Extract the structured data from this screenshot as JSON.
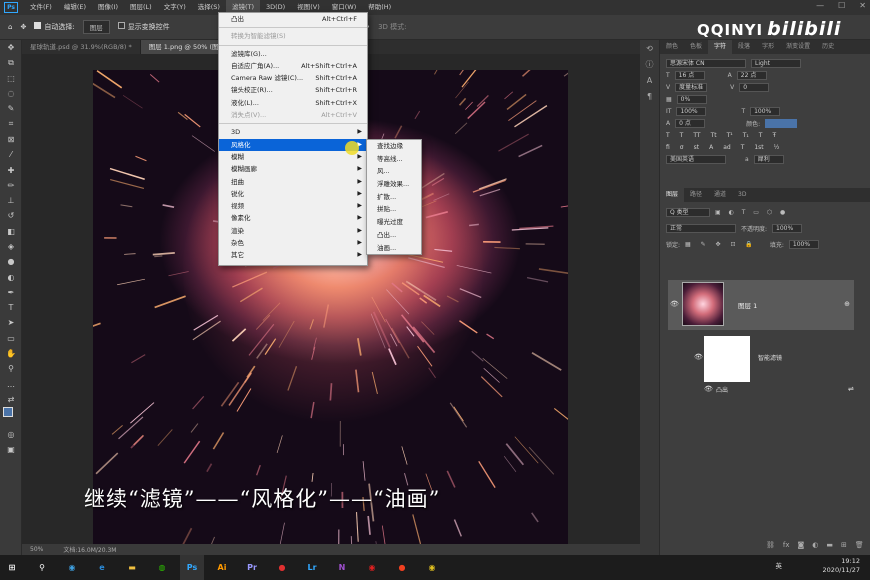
{
  "menubar": {
    "logo": "Ps",
    "items": [
      "文件(F)",
      "编辑(E)",
      "图像(I)",
      "图层(L)",
      "文字(Y)",
      "选择(S)",
      "滤镜(T)",
      "3D(D)",
      "视图(V)",
      "窗口(W)",
      "帮助(H)"
    ]
  },
  "options": {
    "auto_select_label": "自动选择:",
    "layer_value": "图层",
    "show_transform": "显示变换控件",
    "mode_3d": "3D 模式:"
  },
  "tabs": [
    {
      "label": "星球轨道.psd @ 31.9%(RGB/8) *"
    },
    {
      "label": "图层 1.png @ 50% (图层 1, RGB/8) *"
    }
  ],
  "subtitle": "继续“滤镜”——“风格化”——“油画”",
  "statusbar": {
    "zoom": "50%",
    "doc": "文档:16.0M/20.3M"
  },
  "watermark": {
    "text": "QQINYI",
    "brand": "bilibili"
  },
  "filter_menu": {
    "top": [
      {
        "label": "凸出",
        "shortcut": "Alt+Ctrl+F"
      },
      {
        "label": "转换为智能滤镜(S)",
        "shortcut": "",
        "disabled": true
      }
    ],
    "middle": [
      {
        "label": "滤镜库(G)...",
        "shortcut": ""
      },
      {
        "label": "自适应广角(A)...",
        "shortcut": "Alt+Shift+Ctrl+A"
      },
      {
        "label": "Camera Raw 滤镜(C)...",
        "shortcut": "Shift+Ctrl+A"
      },
      {
        "label": "镜头校正(R)...",
        "shortcut": "Shift+Ctrl+R"
      },
      {
        "label": "液化(L)...",
        "shortcut": "Shift+Ctrl+X"
      },
      {
        "label": "消失点(V)...",
        "shortcut": "Alt+Ctrl+V",
        "disabled": true
      }
    ],
    "groups": [
      "3D",
      "风格化",
      "模糊",
      "模糊画廊",
      "扭曲",
      "锐化",
      "视频",
      "像素化",
      "渲染",
      "杂色",
      "其它"
    ],
    "highlighted": "风格化"
  },
  "stylize_submenu": [
    "查找边缘",
    "等高线...",
    "风...",
    "浮雕效果...",
    "扩散...",
    "拼贴...",
    "曝光过度",
    "凸出...",
    "油画..."
  ],
  "right_panel": {
    "top_tabs": [
      "颜色",
      "色板",
      "字符",
      "段落",
      "字形",
      "渐变设置",
      "历史"
    ],
    "font_family": "思源宋体 CN",
    "font_style": "Light",
    "font_size": "16 点",
    "leading": "22 点",
    "kerning": "度量标准",
    "tracking": "0",
    "scale_v": "0%",
    "scale_h": "100%",
    "scale_v2": "100%",
    "baseline": "0 点",
    "color_label": "颜色:",
    "language": "美国英语",
    "antialias": "犀利",
    "layers_tabs": [
      "图层",
      "路径",
      "通道",
      "3D"
    ],
    "kind_filter": "Q 类型",
    "blend_mode": "正常",
    "opacity_label": "不透明度:",
    "opacity": "100%",
    "lock_label": "锁定:",
    "fill_label": "填充:",
    "fill": "100%",
    "layer_name": "图层 1",
    "smart_filter_label": "智能滤镜",
    "effect_name": "凸出",
    "accent_color": "#4a73a8"
  },
  "tray": {
    "time": "19:12",
    "date": "2020/11/27",
    "ime": "英"
  },
  "taskbar": [
    "Ps",
    "Ai",
    "Pr",
    "Lr"
  ]
}
